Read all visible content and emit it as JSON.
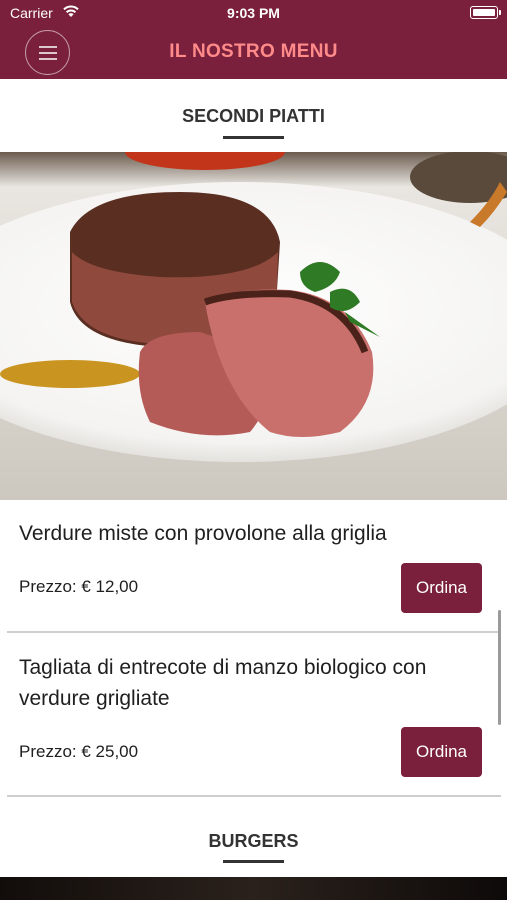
{
  "status_bar": {
    "carrier": "Carrier",
    "time": "9:03 PM"
  },
  "nav": {
    "title": "IL NOSTRO MENU",
    "menu_icon": "hamburger-icon"
  },
  "sections": [
    {
      "title": "SECONDI PIATTI",
      "items": [
        {
          "name": "Verdure miste con provolone alla griglia",
          "price": "Prezzo: € 12,00",
          "button": "Ordina"
        },
        {
          "name": "Tagliata di entrecote di manzo biologico con verdure grigliate",
          "price": "Prezzo: € 25,00",
          "button": "Ordina"
        }
      ]
    },
    {
      "title": "BURGERS"
    }
  ],
  "colors": {
    "brand": "#7a1f3c",
    "nav_title": "#ff8a8a"
  }
}
